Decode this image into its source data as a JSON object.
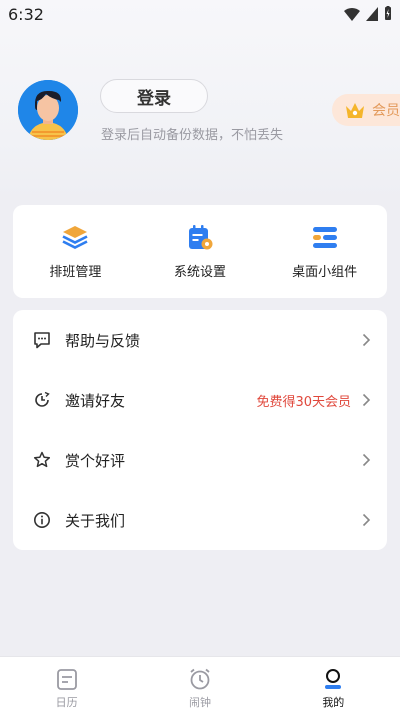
{
  "status": {
    "time": "6:32"
  },
  "profile": {
    "login_label": "登录",
    "hint": "登录后自动备份数据，不怕丢失",
    "vip_label": "会员"
  },
  "tools": [
    {
      "label": "排班管理",
      "icon": "layers-icon"
    },
    {
      "label": "系统设置",
      "icon": "calendar-settings-icon"
    },
    {
      "label": "桌面小组件",
      "icon": "widget-icon"
    }
  ],
  "menu": [
    {
      "label": "帮助与反馈",
      "icon": "feedback-icon",
      "extra": ""
    },
    {
      "label": "邀请好友",
      "icon": "invite-icon",
      "extra": "免费得30天会员"
    },
    {
      "label": "赏个好评",
      "icon": "star-icon",
      "extra": ""
    },
    {
      "label": "关于我们",
      "icon": "info-icon",
      "extra": ""
    }
  ],
  "tabs": [
    {
      "label": "日历",
      "icon": "calendar-icon",
      "active": false
    },
    {
      "label": "闹钟",
      "icon": "alarm-icon",
      "active": false
    },
    {
      "label": "我的",
      "icon": "profile-icon",
      "active": true
    }
  ],
  "colors": {
    "accent": "#2f7ef0",
    "vip": "#e39a5b",
    "promo": "#e0483c"
  }
}
